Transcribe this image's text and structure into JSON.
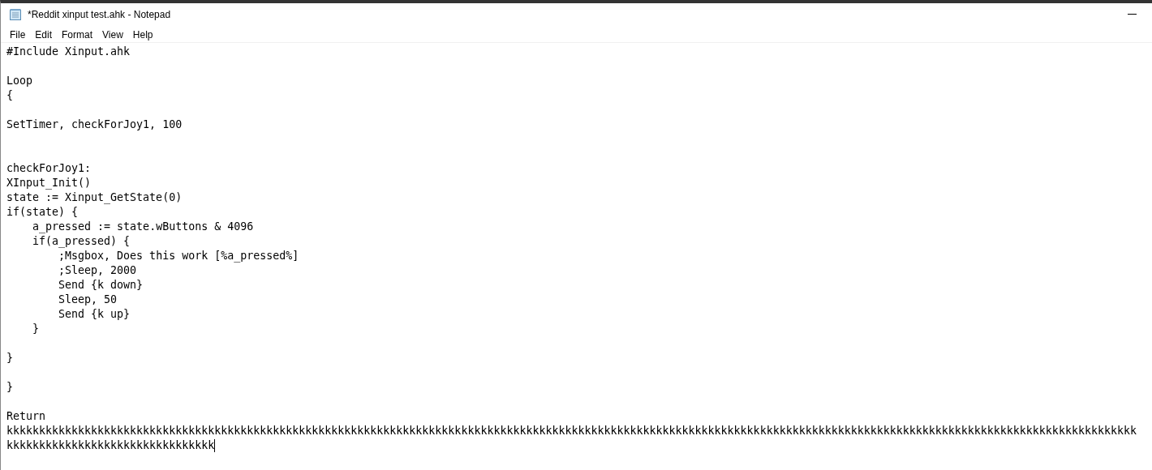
{
  "window": {
    "title": "*Reddit xinput test.ahk - Notepad"
  },
  "menu": [
    {
      "label": "File"
    },
    {
      "label": "Edit"
    },
    {
      "label": "Format"
    },
    {
      "label": "View"
    },
    {
      "label": "Help"
    }
  ],
  "editor": {
    "text": "#Include Xinput.ahk\n\nLoop\n{\n\nSetTimer, checkForJoy1, 100\n\n\ncheckForJoy1:\nXInput_Init()\nstate := Xinput_GetState(0)\nif(state) {\n    a_pressed := state.wButtons & 4096\n    if(a_pressed) {\n        ;Msgbox, Does this work [%a_pressed%]\n        ;Sleep, 2000\n        Send {k down}\n        Sleep, 50\n        Send {k up}\n    }\n\n}\n\n}\n\nReturn\nkkkkkkkkkkkkkkkkkkkkkkkkkkkkkkkkkkkkkkkkkkkkkkkkkkkkkkkkkkkkkkkkkkkkkkkkkkkkkkkkkkkkkkkkkkkkkkkkkkkkkkkkkkkkkkkkkkkkkkkkkkkkkkkkkkkkkkkkkkkkkkkkkkkkkkkkkkkkkkkkkkkkkkkkkkkkkkkkkkkkkkkkkkkkkkkkkkkkkkkkkkkkkk"
  }
}
